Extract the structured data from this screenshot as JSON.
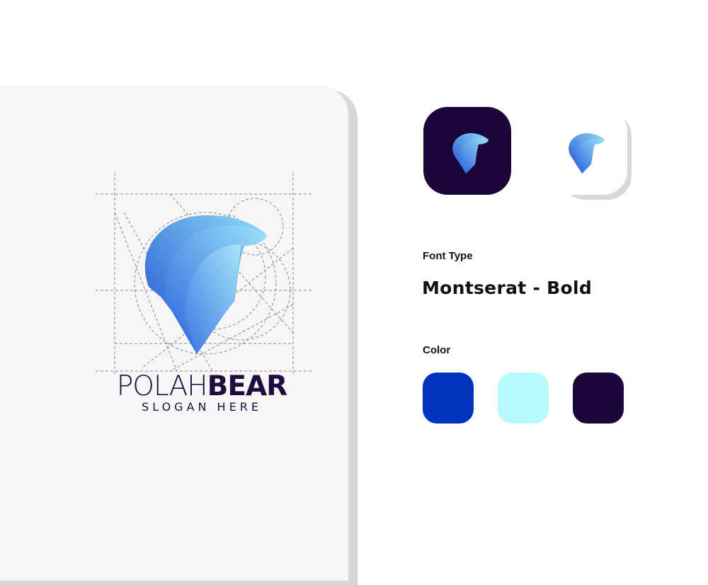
{
  "brand": {
    "name_light": "POLAH",
    "name_bold": "BEAR",
    "slogan": "SLOGAN HERE"
  },
  "font_section": {
    "label": "Font Type",
    "font_name": "Montserat - Bold"
  },
  "color_section": {
    "label": "Color",
    "swatches": [
      {
        "name": "blue",
        "hex": "#0033bb"
      },
      {
        "name": "light-cyan",
        "hex": "#b8fbfe"
      },
      {
        "name": "dark-purple",
        "hex": "#1b063a"
      }
    ]
  },
  "colors": {
    "dark_icon_background": "#1b063a",
    "text_dark": "#1f0d3f",
    "logo_gradient_start": "#1a4fd0",
    "logo_gradient_end": "#8fe3f8"
  }
}
